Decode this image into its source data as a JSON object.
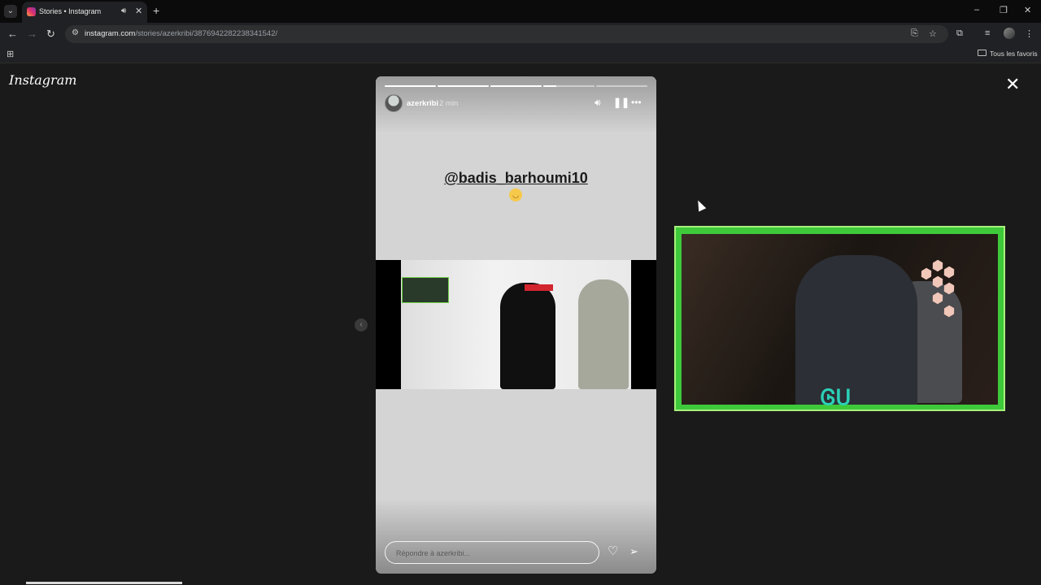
{
  "browser": {
    "tab_title": "Stories • Instagram",
    "tab_audio_icon": "speaker-icon",
    "tab_close": "✕",
    "new_tab": "+",
    "url_host": "instagram.com",
    "url_path": "/stories/azerkribi/3876942282238341542/",
    "bookmark_folder": "Tous les favoris",
    "window_controls": [
      "–",
      "❐",
      "✕"
    ]
  },
  "page": {
    "logo": "Instagram",
    "close": "✕",
    "prev": "‹"
  },
  "story": {
    "username": "azerkribi",
    "time": "2 min",
    "progress": [
      1,
      1,
      1,
      0.25,
      0
    ],
    "mention": "@badis_barhoumi10",
    "reply_placeholder": "Répondre à azerkribi...",
    "controls": {
      "mute_icon": "speaker-icon",
      "pause_icon": "pause-icon",
      "more_icon": "more-icon"
    }
  },
  "overlay": {
    "logo_text": "Ꮆᑌ"
  },
  "colors": {
    "page_bg": "#1a1a1a",
    "story_bg": "#d4d4d4",
    "cam_frame": "#3ec93b",
    "accent_red": "#d2252e"
  }
}
